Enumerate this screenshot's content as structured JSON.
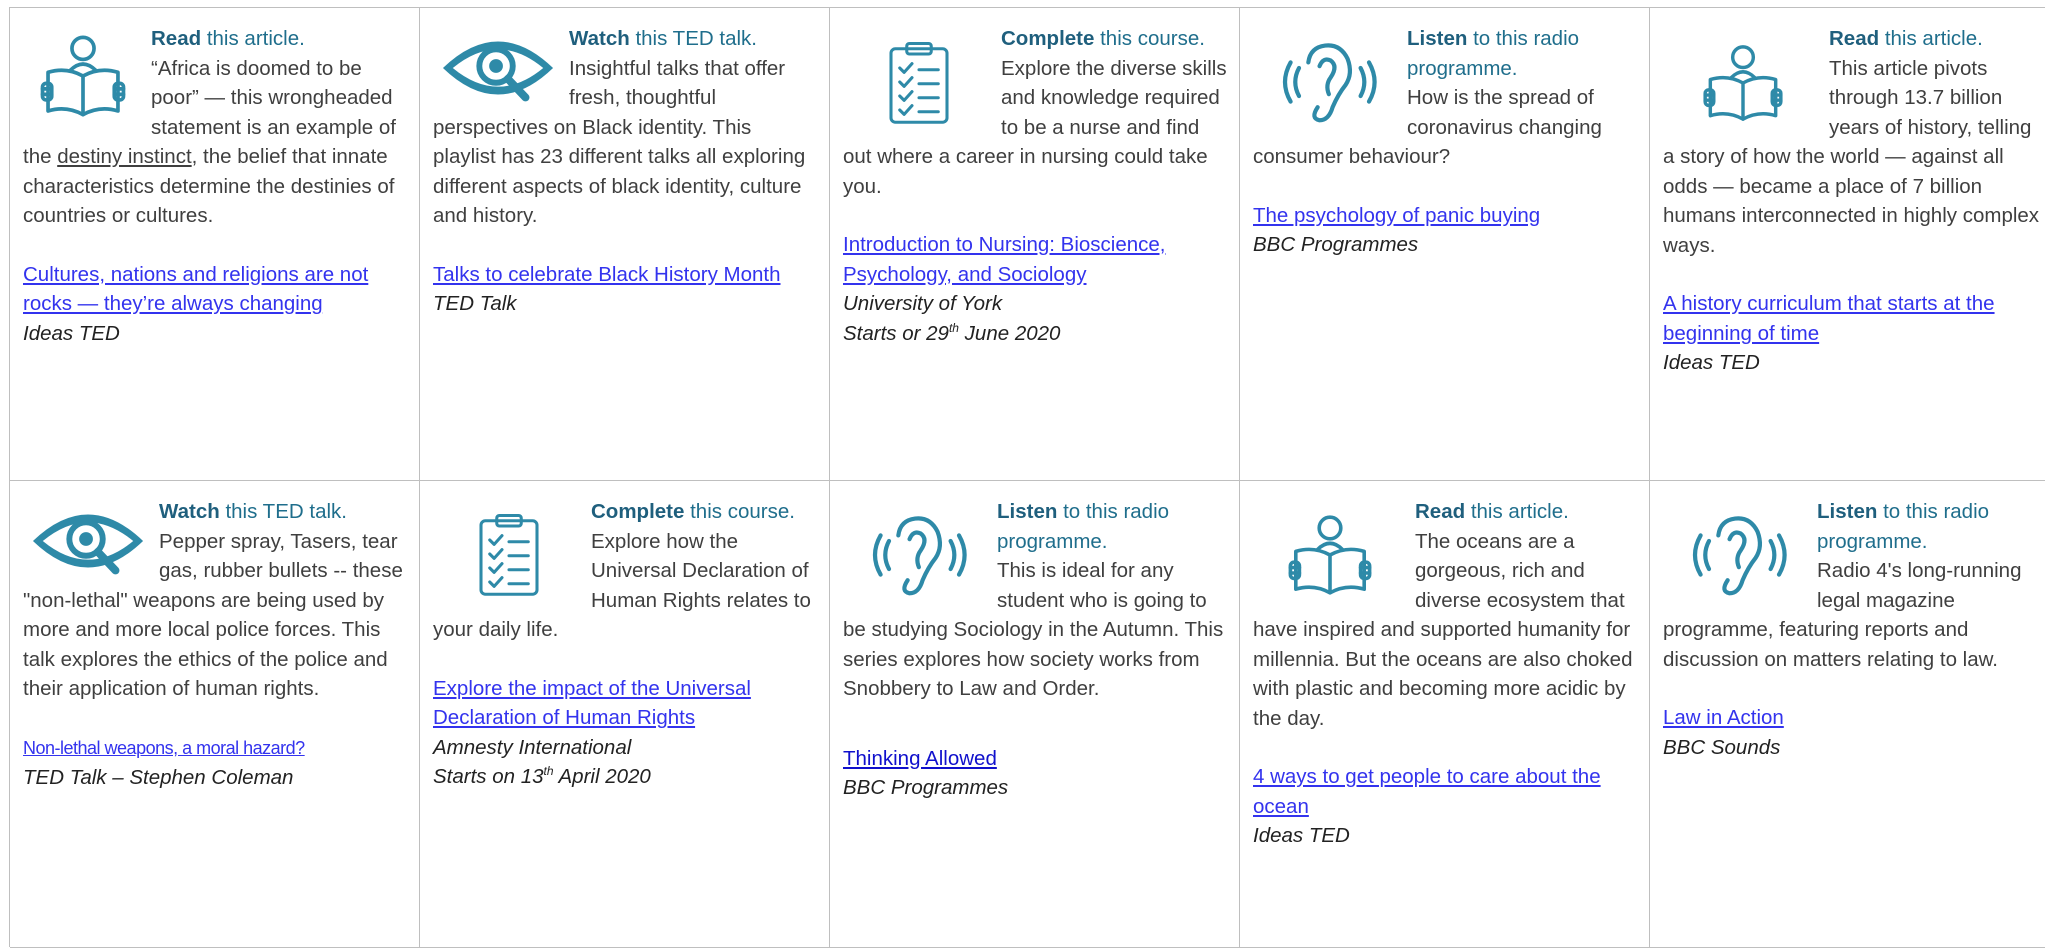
{
  "colors": {
    "icon": "#2e8aa8",
    "heading": "#1f5f7d",
    "link": "#3333ee",
    "grid": "#bfbfbf"
  },
  "cells": [
    {
      "icon": "reader-icon",
      "action": "Read",
      "rest": " this article.",
      "desc_a": "“Africa is doomed to be poor” — this wrongheaded statement is an example of the ",
      "desc_u": "destiny instinct",
      "desc_b": ", the belief that innate characteristics determine the destinies of countries or cultures.",
      "link": "Cultures, nations and religions are not rocks — they’re always changing",
      "source": "Ideas TED"
    },
    {
      "icon": "eye-icon",
      "action": "Watch",
      "rest": " this TED talk.",
      "desc": "Insightful talks that offer fresh, thoughtful perspectives on Black identity. This playlist has 23 different talks all exploring different aspects of black identity, culture and history.",
      "link": "Talks to celebrate Black History Month",
      "source": "TED Talk"
    },
    {
      "icon": "clipboard-icon",
      "action": "Complete",
      "rest": " this course.",
      "desc": "Explore the diverse skills and knowledge required to be a nurse and find out where a career in nursing could take you.",
      "link": "Introduction to Nursing: Bioscience, Psychology, and Sociology",
      "source": "University of York",
      "date_a": "Starts or 29",
      "date_sup": "th",
      "date_b": " June 2020"
    },
    {
      "icon": "ear-icon",
      "action": "Listen",
      "rest": " to this radio programme.",
      "desc": "How is the spread of coronavirus changing consumer behaviour?",
      "link": "The psychology of panic buying",
      "source": "BBC Programmes"
    },
    {
      "icon": "reader-icon",
      "action": "Read",
      "rest": " this article.",
      "desc": "This article pivots through 13.7 billion years of history, telling a story of how the world — against all odds — became a place of 7 billion humans interconnected in highly complex ways.",
      "link": "A history curriculum that starts at the beginning of time",
      "source": "Ideas TED"
    },
    {
      "icon": "eye-icon",
      "action": "Watch",
      "rest": " this TED talk.",
      "desc": "Pepper spray, Tasers, tear gas, rubber bullets -- these \"non-lethal\" weapons are being used by more and more local police forces. This talk explores the ethics of the police and their application of human rights.",
      "link": "Non-lethal weapons, a moral hazard?",
      "source": "TED Talk – Stephen Coleman"
    },
    {
      "icon": "clipboard-icon",
      "action": "Complete",
      "rest": " this course.",
      "desc": "Explore how the Universal Declaration of Human Rights relates to your daily life.",
      "link": "Explore the impact of the Universal Declaration of Human Rights",
      "source": "Amnesty International",
      "date_a": "Starts on 13",
      "date_sup": "th",
      "date_b": " April 2020"
    },
    {
      "icon": "ear-icon",
      "action": "Listen",
      "rest": " to this radio programme.",
      "desc": "This is ideal for any student who is going to be studying Sociology in the Autumn. This series explores how society works from Snobbery to Law and Order.",
      "link": "Thinking Allowed",
      "source": "BBC Programmes"
    },
    {
      "icon": "reader-icon",
      "action": "Read",
      "rest": " this article.",
      "desc": "The oceans are a gorgeous, rich and diverse ecosystem that have inspired and supported humanity for millennia. But the oceans are also choked with plastic and becoming more acidic by the day.",
      "link": "4 ways to get people to care about the ocean",
      "source": "Ideas TED"
    },
    {
      "icon": "ear-icon",
      "action": "Listen",
      "rest": " to this radio programme.",
      "desc": "Radio 4's long-running legal magazine programme, featuring reports and discussion on matters relating to law.",
      "link": "Law in Action",
      "source": "BBC Sounds"
    }
  ]
}
